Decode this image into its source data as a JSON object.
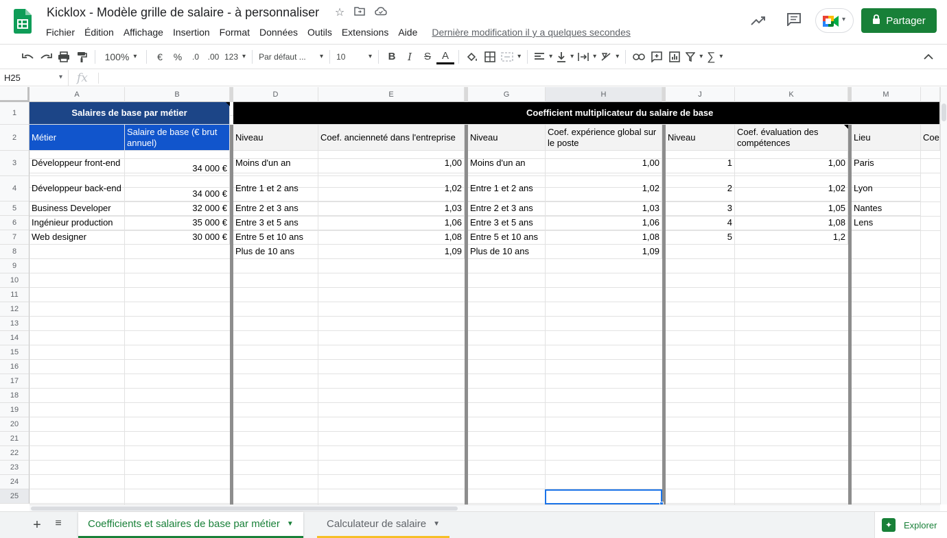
{
  "app": {
    "title": "Kicklox - Modèle grille de salaire - à personnaliser",
    "last_edit": "Dernière modification il y a quelques secondes",
    "share_label": "Partager",
    "brand_color": "#188038"
  },
  "menu": [
    "Fichier",
    "Édition",
    "Affichage",
    "Insertion",
    "Format",
    "Données",
    "Outils",
    "Extensions",
    "Aide"
  ],
  "toolbar": {
    "zoom": "100%",
    "currency": "€",
    "percent": "%",
    "dec_less": ".0",
    "dec_more": ".00",
    "number_format": "123",
    "font": "Par défaut ...",
    "font_size": "10",
    "bold": "B",
    "italic": "I",
    "strike": "S",
    "text_color": "A"
  },
  "formula_bar": {
    "name_box": "H25",
    "fx": "fx"
  },
  "columns": [
    "A",
    "B",
    "D",
    "E",
    "G",
    "H",
    "J",
    "K",
    "M"
  ],
  "rows": [
    "1",
    "2",
    "3",
    "4",
    "5",
    "6",
    "7",
    "8",
    "9",
    "10",
    "11",
    "12",
    "13",
    "14",
    "15",
    "16",
    "17",
    "18",
    "19",
    "20",
    "21",
    "22",
    "23",
    "24",
    "25"
  ],
  "sheet": {
    "header_left": "Salaires de base par métier",
    "header_right": "Coefficient multiplicateur du salaire de base",
    "col_metier": "Métier",
    "col_salaire": "Salaire de base (€ brut annuel)",
    "col_niveau_d": "Niveau",
    "col_coef_anc": "Coef. ancienneté dans l'entreprise",
    "col_niveau_g": "Niveau",
    "col_coef_exp": "Coef. expérience global sur le poste",
    "col_niveau_j": "Niveau",
    "col_coef_eval": "Coef. évaluation des compétences",
    "col_lieu": "Lieu",
    "col_coef_lieu": "Coe",
    "metiers": [
      {
        "name": "Développeur front-end",
        "salaire": "34 000 €"
      },
      {
        "name": "Développeur back-end",
        "salaire": "34 000 €"
      },
      {
        "name": "Business Developer",
        "salaire": "32 000 €"
      },
      {
        "name": "Ingénieur production",
        "salaire": "35 000 €"
      },
      {
        "name": "Web designer",
        "salaire": "30 000 €"
      }
    ],
    "anciennete": [
      {
        "niveau": "Moins d'un an",
        "coef": "1,00"
      },
      {
        "niveau": "Entre 1 et 2 ans",
        "coef": "1,02"
      },
      {
        "niveau": "Entre 2 et 3 ans",
        "coef": "1,03"
      },
      {
        "niveau": "Entre 3 et 5 ans",
        "coef": "1,06"
      },
      {
        "niveau": "Entre 5 et 10 ans",
        "coef": "1,08"
      },
      {
        "niveau": "Plus de 10 ans",
        "coef": "1,09"
      }
    ],
    "experience": [
      {
        "niveau": "Moins d'un an",
        "coef": "1,00"
      },
      {
        "niveau": "Entre 1 et 2 ans",
        "coef": "1,02"
      },
      {
        "niveau": "Entre 2 et 3 ans",
        "coef": "1,03"
      },
      {
        "niveau": "Entre 3 et 5 ans",
        "coef": "1,06"
      },
      {
        "niveau": "Entre 5 et 10 ans",
        "coef": "1,08"
      },
      {
        "niveau": "Plus de 10 ans",
        "coef": "1,09"
      }
    ],
    "evaluation": [
      {
        "niveau": "1",
        "coef": "1,00"
      },
      {
        "niveau": "2",
        "coef": "1,02"
      },
      {
        "niveau": "3",
        "coef": "1,05"
      },
      {
        "niveau": "4",
        "coef": "1,08"
      },
      {
        "niveau": "5",
        "coef": "1,2"
      }
    ],
    "lieux": [
      "Paris",
      "Lyon",
      "Nantes",
      "Lens"
    ],
    "colors": {
      "header_left_bg": "#1c4587",
      "header_sub_bg": "#1155cc",
      "header_right_bg": "#000000"
    }
  },
  "tabs": [
    {
      "label": "Coefficients et salaires de base par métier",
      "active": true
    },
    {
      "label": "Calculateur de salaire",
      "active": false
    }
  ],
  "explore_label": "Explorer"
}
